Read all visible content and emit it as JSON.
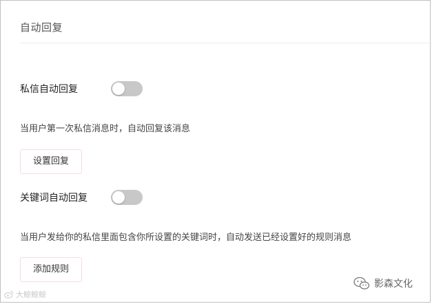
{
  "page": {
    "title": "自动回复"
  },
  "auto_reply": {
    "label": "私信自动回复",
    "enabled": false,
    "description": "当用户第一次私信消息时，自动回复该消息",
    "button_label": "设置回复"
  },
  "keyword_reply": {
    "label": "关键词自动回复",
    "enabled": false,
    "description": "当用户发给你的私信里面包含你所设置的关键词时，自动发送已经设置好的规则消息",
    "button_label": "添加规则"
  },
  "watermarks": {
    "left_text": "大鲸鲸鲸",
    "right_text": "影森文化"
  },
  "colors": {
    "toggle_off": "#c8c8c8",
    "button_border": "#efdde6",
    "divider": "#ececec"
  }
}
